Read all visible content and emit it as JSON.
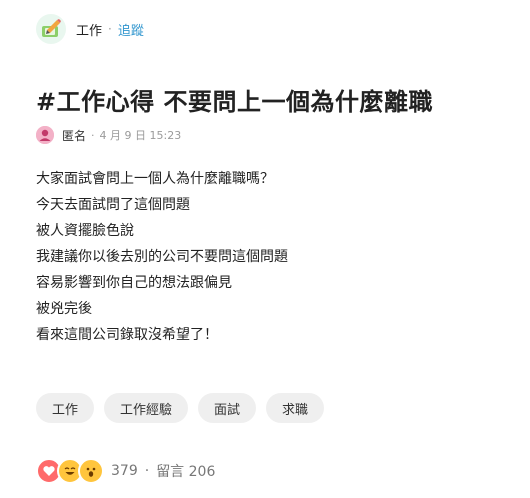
{
  "forum": {
    "name": "工作",
    "separator": "·",
    "follow_label": "追蹤"
  },
  "post": {
    "title": "#工作心得 不要問上一個為什麼離職",
    "author": "匿名",
    "separator": "·",
    "timestamp": "4 月 9 日 15:23",
    "body": [
      "大家面試會問上一個人為什麼離職嗎？",
      "今天去面試問了這個問題",
      "被人資擺臉色說",
      "我建議你以後去別的公司不要問這個問題",
      "容易影響到你自己的想法跟偏見",
      "被兇完後",
      "看來這間公司錄取沒希望了！"
    ],
    "tags": [
      "工作",
      "工作經驗",
      "面試",
      "求職"
    ]
  },
  "stats": {
    "reaction_icons": [
      "heart-reaction",
      "laugh-reaction",
      "wow-reaction"
    ],
    "likes": "379",
    "separator": "·",
    "comments": "留言 206"
  },
  "colors": {
    "accent": "#3397cf",
    "tag_bg": "#efefef",
    "muted": "#9a9a9a"
  }
}
